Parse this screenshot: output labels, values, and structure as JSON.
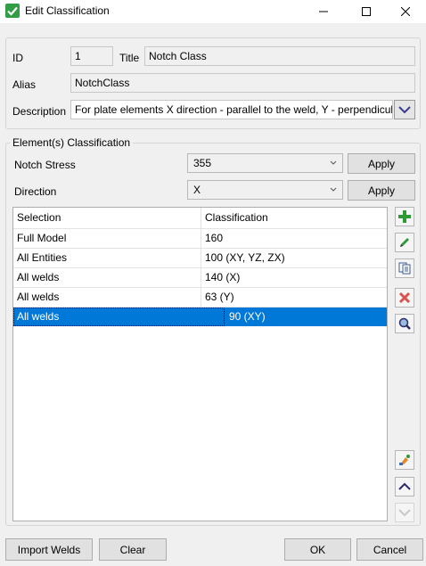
{
  "window": {
    "title": "Edit Classification"
  },
  "form": {
    "id_label": "ID",
    "id_value": "1",
    "title_label": "Title",
    "title_value": "Notch Class",
    "alias_label": "Alias",
    "alias_value": "NotchClass",
    "description_label": "Description",
    "description_value": "For plate elements X direction - parallel to the weld, Y - perpendicul"
  },
  "classification": {
    "group_label": "Element(s) Classification",
    "notch_stress_label": "Notch Stress",
    "notch_stress_value": "355",
    "direction_label": "Direction",
    "direction_value": "X",
    "apply_label": "Apply"
  },
  "table": {
    "columns": [
      "Selection",
      "Classification"
    ],
    "rows": [
      {
        "selection": "Full Model",
        "classification": "160"
      },
      {
        "selection": "All Entities",
        "classification": "100 (XY, YZ, ZX)"
      },
      {
        "selection": "All welds",
        "classification": "140 (X)"
      },
      {
        "selection": "All welds",
        "classification": "63 (Y)"
      },
      {
        "selection": "All welds",
        "classification": "90 (XY)"
      }
    ],
    "selected_index": 4
  },
  "tools": [
    "add-icon",
    "edit-icon",
    "copy-icon",
    "delete-icon",
    "zoom-icon",
    "paint-icon",
    "move-up-icon",
    "move-down-icon"
  ],
  "footer": {
    "import_welds_label": "Import Welds",
    "clear_label": "Clear",
    "ok_label": "OK",
    "cancel_label": "Cancel"
  },
  "colors": {
    "selection": "#0078d7",
    "add_green": "#2e9a35",
    "delete_red": "#d9534f"
  }
}
